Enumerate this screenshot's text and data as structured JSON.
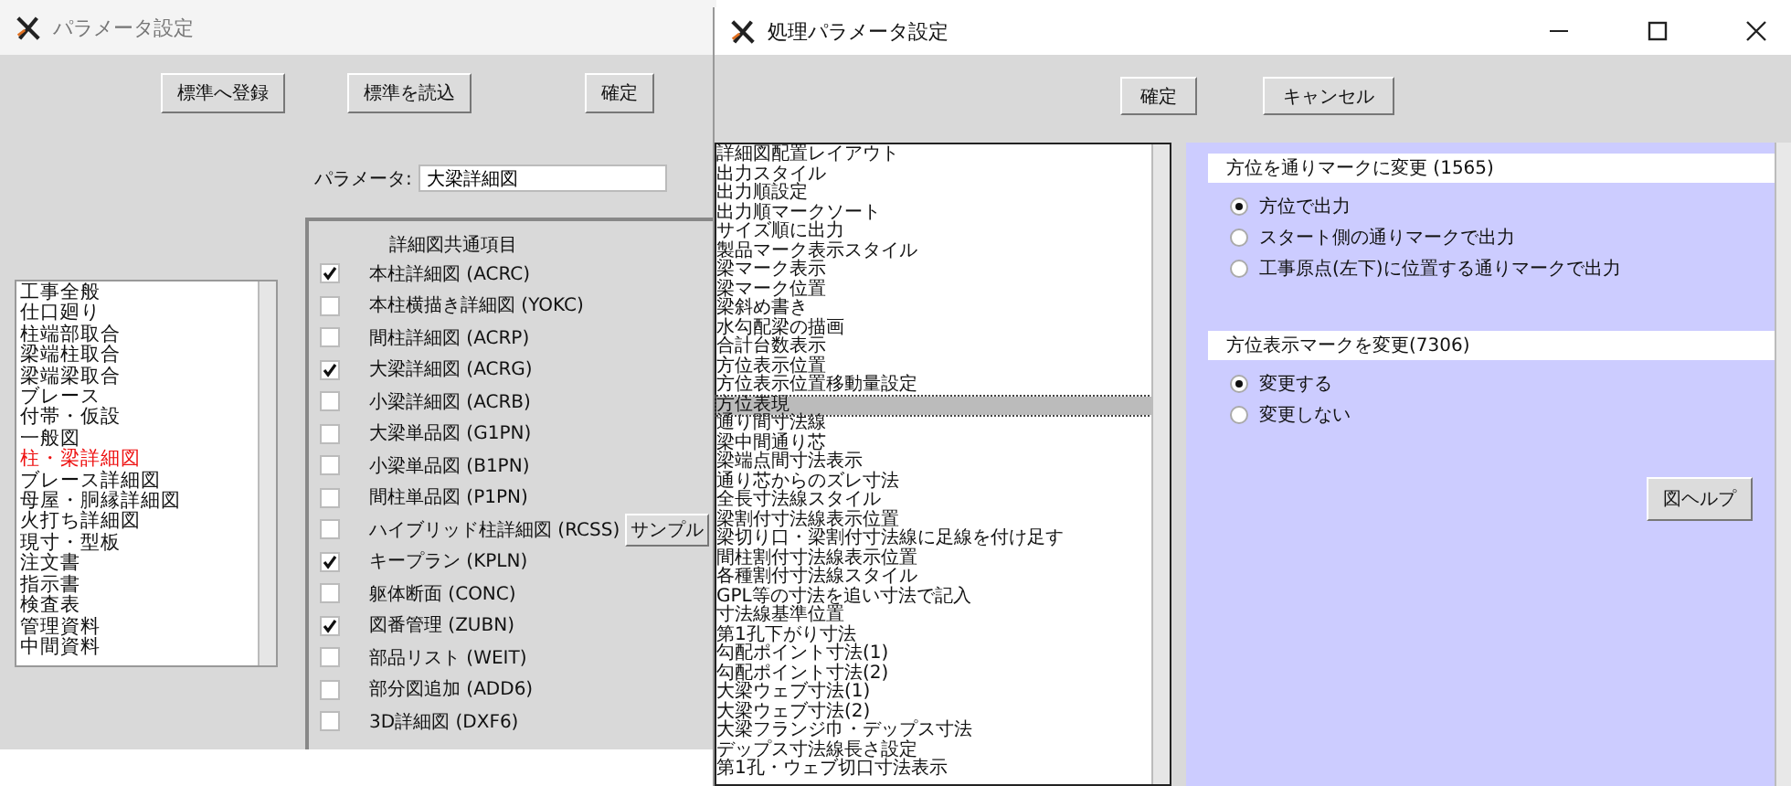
{
  "back_window": {
    "title": "パラメータ設定",
    "buttons": [
      "標準へ登録",
      "標準を読込",
      "確定"
    ],
    "parameter": {
      "label": "パラメータ:",
      "value": "大梁詳細図"
    },
    "categories": [
      {
        "label": "工事全般",
        "selected": false
      },
      {
        "label": "仕口廻り",
        "selected": false
      },
      {
        "label": "柱端部取合",
        "selected": false
      },
      {
        "label": "梁端柱取合",
        "selected": false
      },
      {
        "label": "梁端梁取合",
        "selected": false
      },
      {
        "label": "ブレース",
        "selected": false
      },
      {
        "label": "付帯・仮設",
        "selected": false
      },
      {
        "label": "一般図",
        "selected": false
      },
      {
        "label": "柱・梁詳細図",
        "selected": true
      },
      {
        "label": "ブレース詳細図",
        "selected": false
      },
      {
        "label": "母屋・胴縁詳細図",
        "selected": false
      },
      {
        "label": "火打ち詳細図",
        "selected": false
      },
      {
        "label": "現寸・型板",
        "selected": false
      },
      {
        "label": "注文書",
        "selected": false
      },
      {
        "label": "指示書",
        "selected": false
      },
      {
        "label": "検査表",
        "selected": false
      },
      {
        "label": "管理資料",
        "selected": false
      },
      {
        "label": "中間資料",
        "selected": false
      }
    ],
    "common_items": {
      "title": "詳細図共通項目",
      "items": [
        {
          "label": "本柱詳細図 (ACRC)",
          "checked": true
        },
        {
          "label": "本柱横描き詳細図 (YOKC)",
          "checked": false
        },
        {
          "label": "間柱詳細図 (ACRP)",
          "checked": false
        },
        {
          "label": "大梁詳細図 (ACRG)",
          "checked": true
        },
        {
          "label": "小梁詳細図 (ACRB)",
          "checked": false
        },
        {
          "label": "大梁単品図 (G1PN)",
          "checked": false
        },
        {
          "label": "小梁単品図 (B1PN)",
          "checked": false
        },
        {
          "label": "間柱単品図 (P1PN)",
          "checked": false
        },
        {
          "label": "ハイブリッド柱詳細図 (RCSS)",
          "checked": false,
          "button": "サンプル"
        },
        {
          "label": "キープラン (KPLN)",
          "checked": true
        },
        {
          "label": "躯体断面 (CONC)",
          "checked": false
        },
        {
          "label": "図番管理 (ZUBN)",
          "checked": true
        },
        {
          "label": "部品リスト (WEIT)",
          "checked": false
        },
        {
          "label": "部分図追加 (ADD6)",
          "checked": false
        },
        {
          "label": "3D詳細図 (DXF6)",
          "checked": false
        }
      ]
    }
  },
  "front_window": {
    "title": "処理パラメータ設定",
    "buttons": [
      "確定",
      "キャンセル"
    ],
    "settings": [
      {
        "label": "詳細図配置レイアウト",
        "selected": false
      },
      {
        "label": "出力スタイル",
        "selected": false
      },
      {
        "label": "出力順設定",
        "selected": false
      },
      {
        "label": "出力順マークソート",
        "selected": false
      },
      {
        "label": "サイズ順に出力",
        "selected": false
      },
      {
        "label": "製品マーク表示スタイル",
        "selected": false
      },
      {
        "label": "梁マーク表示",
        "selected": false
      },
      {
        "label": "梁マーク位置",
        "selected": false
      },
      {
        "label": "梁斜め書き",
        "selected": false
      },
      {
        "label": "水勾配梁の描画",
        "selected": false
      },
      {
        "label": "合計台数表示",
        "selected": false
      },
      {
        "label": "方位表示位置",
        "selected": false
      },
      {
        "label": "方位表示位置移動量設定",
        "selected": false
      },
      {
        "label": "方位表現",
        "selected": true
      },
      {
        "label": "通り間寸法線",
        "selected": false
      },
      {
        "label": "梁中間通り芯",
        "selected": false
      },
      {
        "label": "梁端点間寸法表示",
        "selected": false
      },
      {
        "label": "通り芯からのズレ寸法",
        "selected": false
      },
      {
        "label": "全長寸法線スタイル",
        "selected": false
      },
      {
        "label": "梁割付寸法線表示位置",
        "selected": false
      },
      {
        "label": "梁切り口・梁割付寸法線に足線を付け足す",
        "selected": false
      },
      {
        "label": "間柱割付寸法線表示位置",
        "selected": false
      },
      {
        "label": "各種割付寸法線スタイル",
        "selected": false
      },
      {
        "label": "GPL等の寸法を追い寸法で記入",
        "selected": false
      },
      {
        "label": "寸法線基準位置",
        "selected": false
      },
      {
        "label": "第1孔下がり寸法",
        "selected": false
      },
      {
        "label": "勾配ポイント寸法(1)",
        "selected": false
      },
      {
        "label": "勾配ポイント寸法(2)",
        "selected": false
      },
      {
        "label": "大梁ウェブ寸法(1)",
        "selected": false
      },
      {
        "label": "大梁ウェブ寸法(2)",
        "selected": false
      },
      {
        "label": "大梁フランジ巾・デップス寸法",
        "selected": false
      },
      {
        "label": "デップス寸法線長さ設定",
        "selected": false
      },
      {
        "label": "第1孔・ウェブ切口寸法表示",
        "selected": false
      }
    ],
    "groups": [
      {
        "title": "方位を通りマークに変更 (1565)",
        "options": [
          {
            "label": "方位で出力",
            "selected": true
          },
          {
            "label": "スタート側の通りマークで出力",
            "selected": false
          },
          {
            "label": "工事原点(左下)に位置する通りマークで出力",
            "selected": false
          }
        ]
      },
      {
        "title": "方位表示マークを変更(7306)",
        "options": [
          {
            "label": "変更する",
            "selected": true
          },
          {
            "label": "変更しない",
            "selected": false
          }
        ]
      }
    ],
    "help_button": "図ヘルプ"
  }
}
